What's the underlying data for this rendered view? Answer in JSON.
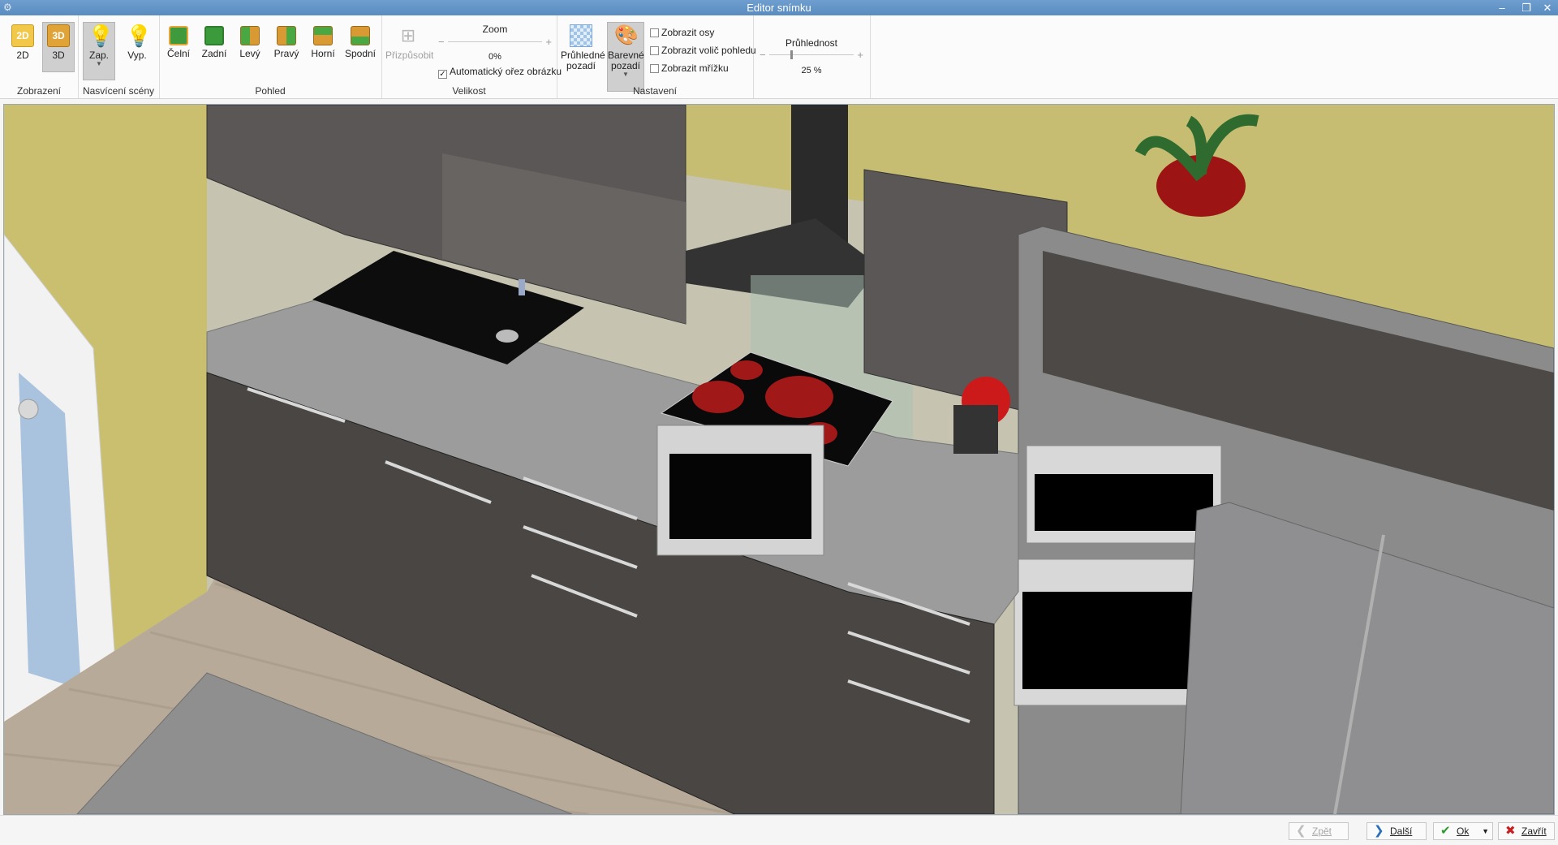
{
  "window": {
    "title": "Editor snímku"
  },
  "ribbon": {
    "groups": {
      "zobrazeni": {
        "label": "Zobrazení",
        "btn_2d": "2D",
        "btn_3d": "3D",
        "icon_2d_text": "2D",
        "icon_3d_text": "3D"
      },
      "nasviceni": {
        "label": "Nasvícení scény",
        "on": "Zap.",
        "off": "Vyp."
      },
      "pohled": {
        "label": "Pohled",
        "items": [
          "Čelní",
          "Zadní",
          "Levý",
          "Pravý",
          "Horní",
          "Spodní"
        ]
      },
      "velikost": {
        "label": "Velikost",
        "fit": "Přizpůsobit",
        "zoom_label": "Zoom",
        "zoom_value": "0%",
        "auto_crop": "Automatický ořez obrázku",
        "auto_crop_checked": true
      },
      "nastaveni": {
        "label": "Nastavení",
        "transparent_bg": [
          "Průhledné",
          "pozadí"
        ],
        "colored_bg": [
          "Barevné",
          "pozadí"
        ],
        "checks": [
          "Zobrazit osy",
          "Zobrazit volič pohledu",
          "Zobrazit mřížku"
        ]
      },
      "pruhlednost": {
        "label": "Průhlednost",
        "value": "25 %",
        "fraction": 0.25
      }
    }
  },
  "footer": {
    "back": "Zpět",
    "next": "Další",
    "ok": "Ok",
    "close": "Zavřít"
  },
  "colors": {
    "titlebar": "#5a8cc0",
    "wall": "#c6bd72",
    "floor": "#b8aa98",
    "cabinet_dark": "#4a4644",
    "counter": "#9c9c9c",
    "hob_ring": "#a01818"
  }
}
